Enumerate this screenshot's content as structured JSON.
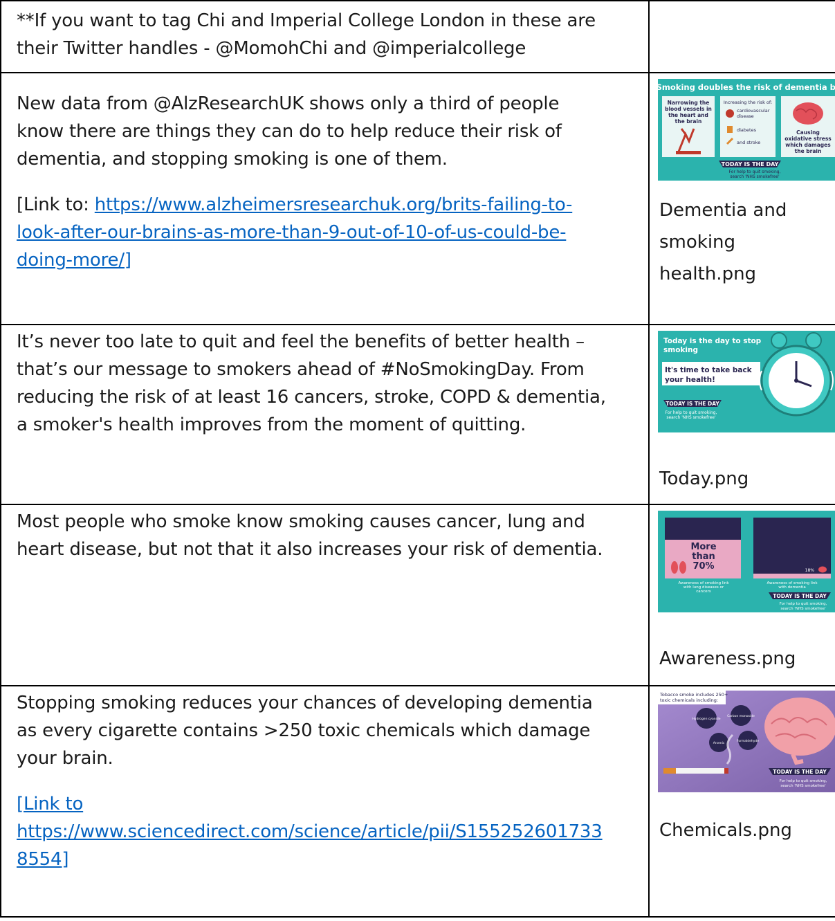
{
  "rows": [
    {
      "lines": [
        "**If you want to tag Chi and Imperial College London in these are",
        "their Twitter handles - @MomohChi and @imperialcollege"
      ]
    },
    {
      "lines": [
        "New data from @AlzResearchUK shows only a third of people",
        "know there are things they can do to help reduce their risk of",
        "dementia, and stopping smoking is one of them."
      ],
      "link_prefix": "[Link to: ",
      "link_lines": [
        "https://www.alzheimersresearchuk.org/brits-failing-to-",
        "look-after-our-brains-as-more-than-9-out-of-10-of-us-could-be-",
        "doing-more/]"
      ],
      "image_filename_lines": [
        "Dementia and",
        "smoking",
        "health.png"
      ],
      "thumb": {
        "title": "Smoking doubles the risk of dementia by",
        "left_caption": [
          "Narrowing the",
          "blood vessels in",
          "the heart and",
          "the brain"
        ],
        "mid_caption_title": "Increasing the risk of:",
        "mid_items": [
          "cardiovascular",
          "disease",
          "diabetes",
          "and stroke"
        ],
        "right_caption": [
          "Causing",
          "oxidative stress",
          "which damages",
          "the brain"
        ],
        "banner": "TODAY IS THE DAY",
        "footer": [
          "For help to quit smoking,",
          "search 'NHS smokefree'"
        ]
      }
    },
    {
      "lines": [
        "It’s never too late to quit and feel the benefits of better health –",
        "that’s our message to smokers ahead of #NoSmokingDay. From",
        "reducing the risk of at least 16 cancers, stroke, COPD & dementia,",
        "a smoker's health improves from the moment of quitting."
      ],
      "image_filename_lines": [
        "Today.png"
      ],
      "thumb": {
        "title": [
          "Today is the day to stop",
          "smoking"
        ],
        "callout": [
          "It's time to take back",
          "your health!"
        ],
        "banner": "TODAY IS THE DAY",
        "footer": [
          "For help to quit smoking,",
          "search 'NHS smokefree'"
        ]
      }
    },
    {
      "lines": [
        "Most people who smoke know smoking causes cancer, lung and",
        "heart disease, but not that it also increases your risk of dementia."
      ],
      "image_filename_lines": [
        "Awareness.png"
      ],
      "thumb": {
        "big_label": [
          "More",
          "than",
          "70%"
        ],
        "small_label": "18%",
        "left_caption": [
          "Awareness of smoking link",
          "with lung diseases or",
          "cancers"
        ],
        "right_caption": [
          "Awareness of smoking link",
          "with dementia"
        ],
        "banner": "TODAY IS THE DAY",
        "footer": [
          "For help to quit smoking,",
          "search 'NHS smokefree'"
        ]
      }
    },
    {
      "lines": [
        "Stopping smoking reduces your chances of developing dementia",
        "as every cigarette contains >250 toxic chemicals which damage",
        "your brain."
      ],
      "link_prefix_line": "[Link to",
      "link_lines": [
        "https://www.sciencedirect.com/science/article/pii/S155252601733",
        "8554]"
      ],
      "image_filename_lines": [
        "Chemicals.png"
      ],
      "thumb": {
        "title": [
          "Tobacco smoke includes 250+",
          "toxic chemicals including:"
        ],
        "chemicals": [
          "Hydrogen cyanide",
          "Carbon monoxide",
          "Arsenic",
          "Formaldehyde"
        ],
        "banner": "TODAY IS THE DAY",
        "footer": [
          "For help to quit smoking,",
          "search 'NHS smokefree'"
        ]
      }
    }
  ],
  "colors": {
    "link": "#0563c1",
    "teal": "#2bb3ad",
    "navy": "#2a2550",
    "pink": "#e9a9c4",
    "purple": "#8c72b8"
  }
}
